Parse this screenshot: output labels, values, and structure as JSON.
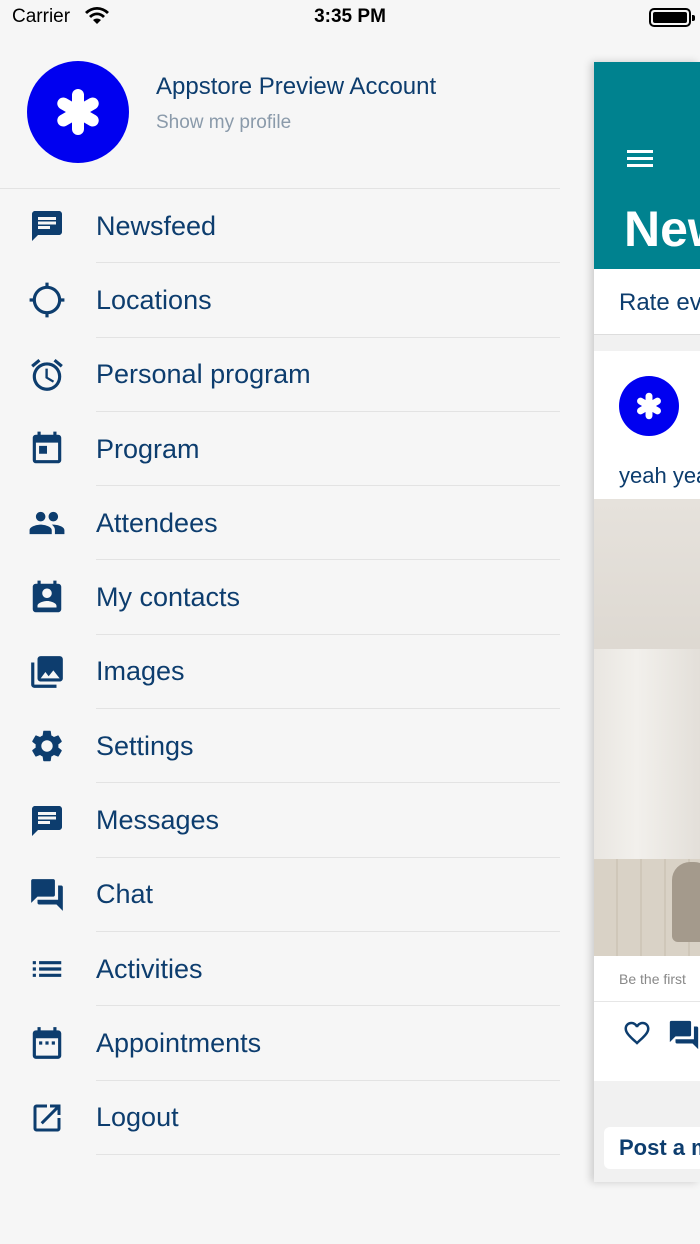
{
  "status_bar": {
    "carrier": "Carrier",
    "time": "3:35 PM"
  },
  "profile": {
    "name": "Appstore Preview Account",
    "link": "Show my profile"
  },
  "menu": [
    {
      "label": "Newsfeed",
      "icon": "newsfeed-icon"
    },
    {
      "label": "Locations",
      "icon": "crosshair-icon"
    },
    {
      "label": "Personal program",
      "icon": "alarm-clock-icon"
    },
    {
      "label": "Program",
      "icon": "calendar-day-icon"
    },
    {
      "label": "Attendees",
      "icon": "people-icon"
    },
    {
      "label": "My contacts",
      "icon": "contact-card-icon"
    },
    {
      "label": "Images",
      "icon": "photo-library-icon"
    },
    {
      "label": "Settings",
      "icon": "gear-icon"
    },
    {
      "label": "Messages",
      "icon": "message-icon"
    },
    {
      "label": "Chat",
      "icon": "chat-icon"
    },
    {
      "label": "Activities",
      "icon": "list-icon"
    },
    {
      "label": "Appointments",
      "icon": "calendar-icon"
    },
    {
      "label": "Logout",
      "icon": "logout-icon"
    }
  ],
  "main": {
    "title": "New",
    "rate_text": "Rate ev",
    "post_text": "yeah yea",
    "likes_text": "Be the first",
    "compose_text": "Post a m"
  },
  "colors": {
    "brand": "#0d3d6e",
    "accent": "#0000f0",
    "header": "#00828f"
  }
}
